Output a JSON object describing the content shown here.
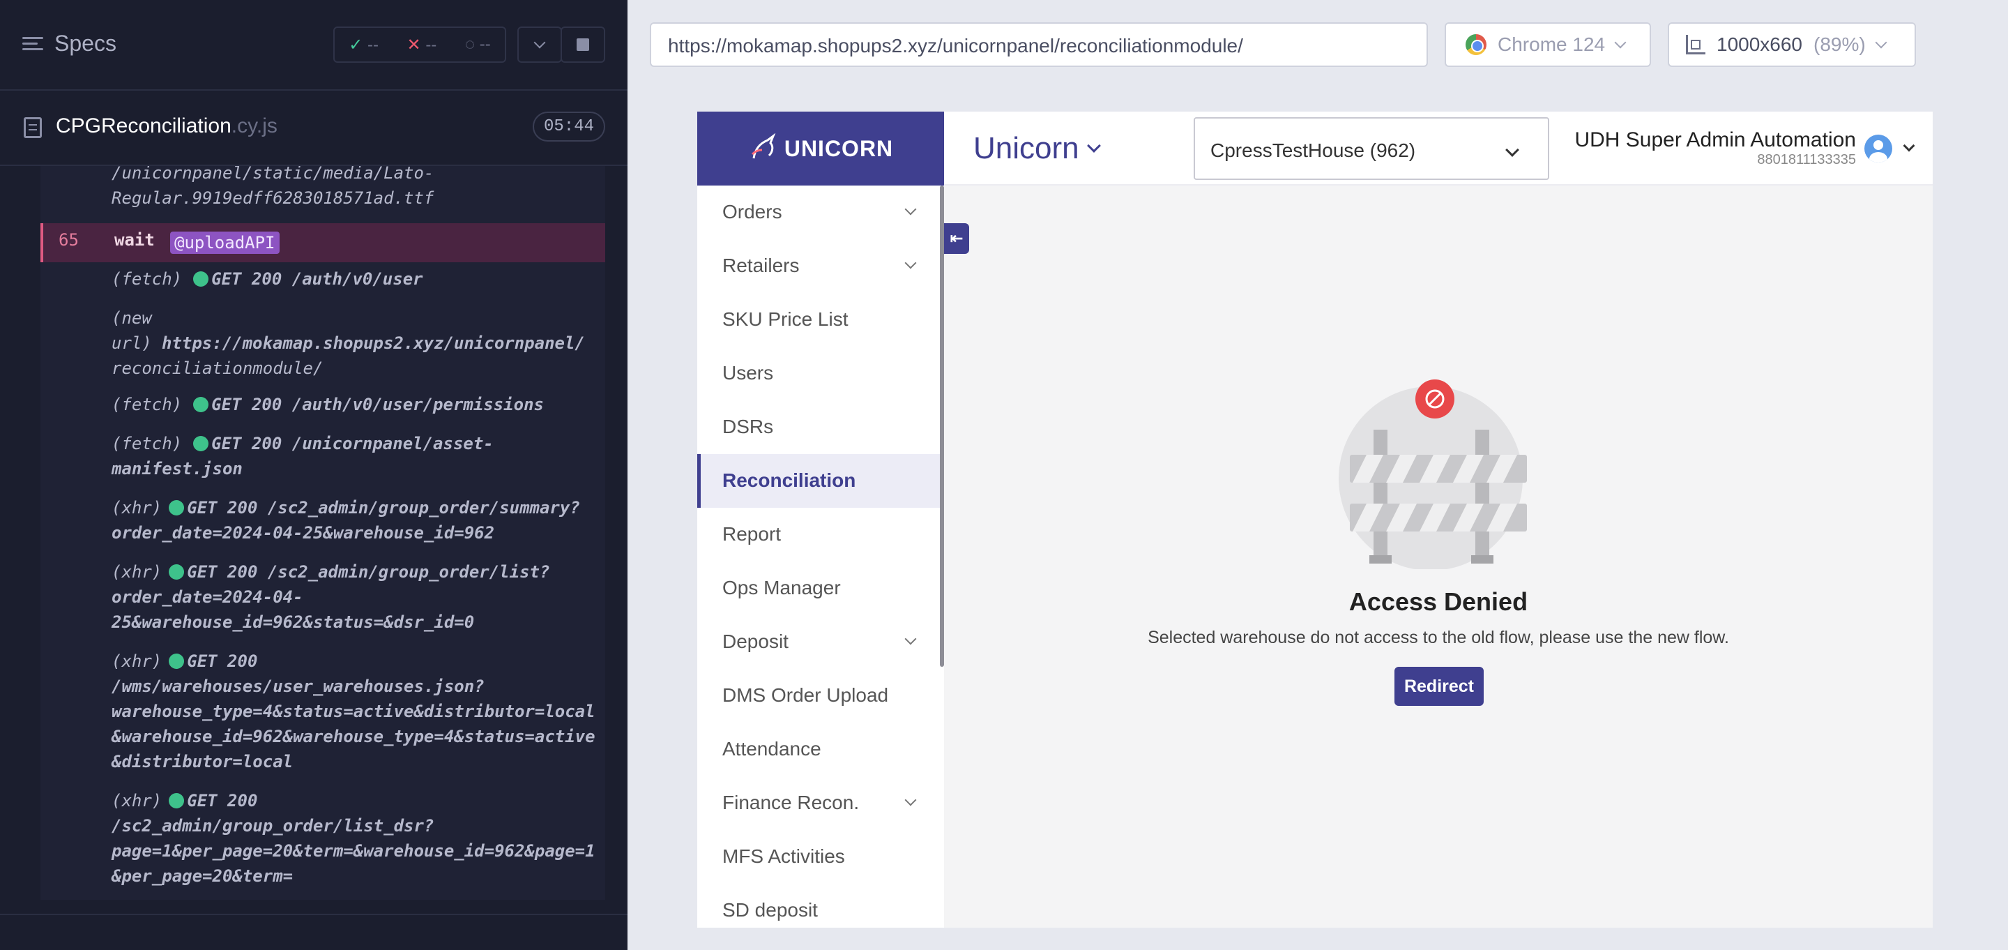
{
  "runner": {
    "specs_title": "Specs",
    "stats": {
      "passed": "--",
      "failed": "--",
      "pending": "--"
    },
    "spec_file": {
      "name": "CPGReconciliation",
      "ext": ".cy.js",
      "duration": "05:44"
    },
    "log": {
      "prev_line_1": "/unicornpanel/static/media/Lato-",
      "prev_line_2": "Regular.9919edff6283018571ad.ttf",
      "wait_num": "65",
      "wait_cmd": "wait",
      "wait_alias": "@uploadAPI",
      "entries": [
        {
          "kind": "(fetch)",
          "lines": [
            "GET 200 /auth/v0/user"
          ]
        },
        {
          "kind": "(new url)",
          "lines": [
            "https://mokamap.shopups2.xyz/unicornpanel/",
            "reconciliationmodule/"
          ]
        },
        {
          "kind": "(fetch)",
          "lines": [
            "GET 200 /auth/v0/user/permissions"
          ]
        },
        {
          "kind": "(fetch)",
          "lines": [
            "GET 200 /unicornpanel/asset-",
            "manifest.json"
          ]
        },
        {
          "kind": "(xhr)",
          "lines": [
            "GET 200 /sc2_admin/group_order/summary?",
            "order_date=2024-04-25&warehouse_id=962"
          ]
        },
        {
          "kind": "(xhr)",
          "lines": [
            "GET 200 /sc2_admin/group_order/list?",
            "order_date=2024-04-",
            "25&warehouse_id=962&status=&dsr_id=0"
          ]
        },
        {
          "kind": "(xhr)",
          "lines": [
            "GET 200",
            "/wms/warehouses/user_warehouses.json?",
            "warehouse_type=4&status=active&distributor=local",
            "&warehouse_id=962&warehouse_type=4&status=active",
            "&distributor=local"
          ]
        },
        {
          "kind": "(xhr)",
          "lines": [
            "GET 200",
            "/sc2_admin/group_order/list_dsr?",
            "page=1&per_page=20&term=&warehouse_id=962&page=1",
            "&per_page=20&term="
          ]
        }
      ]
    }
  },
  "browser": {
    "url": "https://mokamap.shopups2.xyz/unicornpanel/reconciliationmodule/",
    "browser_name": "Chrome 124",
    "viewport": "1000x660",
    "zoom": "(89%)"
  },
  "app": {
    "logo_text": "UNICORN",
    "brand": "Unicorn",
    "warehouse": "CpressTestHouse (962)",
    "user": {
      "name": "UDH Super Admin Automation",
      "phone": "8801811133335"
    },
    "sidebar": [
      {
        "label": "Orders",
        "expandable": true
      },
      {
        "label": "Retailers",
        "expandable": true
      },
      {
        "label": "SKU Price List",
        "expandable": false
      },
      {
        "label": "Users",
        "expandable": false
      },
      {
        "label": "DSRs",
        "expandable": false
      },
      {
        "label": "Reconciliation",
        "expandable": false,
        "active": true
      },
      {
        "label": "Report",
        "expandable": false
      },
      {
        "label": "Ops Manager",
        "expandable": false
      },
      {
        "label": "Deposit",
        "expandable": true
      },
      {
        "label": "DMS Order Upload",
        "expandable": false
      },
      {
        "label": "Attendance",
        "expandable": false
      },
      {
        "label": "Finance Recon.",
        "expandable": true
      },
      {
        "label": "MFS Activities",
        "expandable": false
      },
      {
        "label": "SD deposit",
        "expandable": false
      }
    ],
    "access_denied": {
      "title": "Access Denied",
      "message": "Selected warehouse do not access to the old flow, please use the new flow.",
      "button": "Redirect"
    }
  },
  "colors": {
    "brand": "#3f3f8f",
    "runner_bg": "#1b1e2e",
    "success_dot": "#3ec28b",
    "danger": "#e8484a"
  }
}
